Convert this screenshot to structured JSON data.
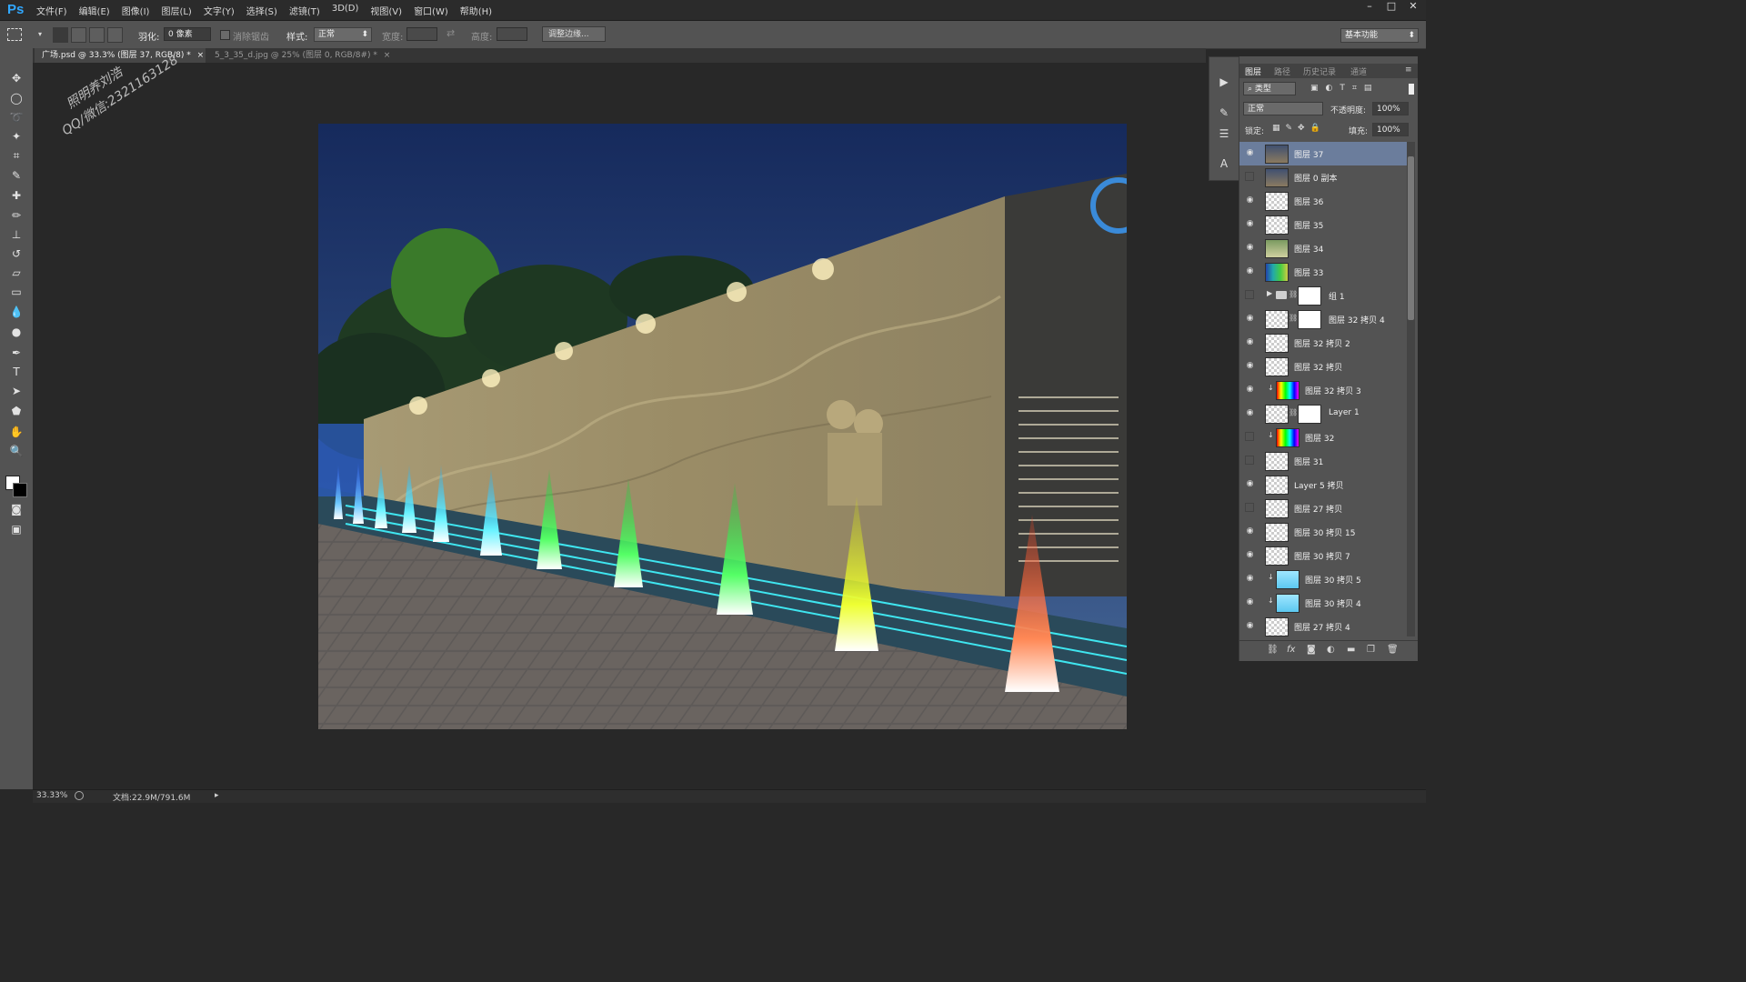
{
  "app": {
    "logo": "Ps",
    "window_controls": [
      "–",
      "□",
      "✕"
    ]
  },
  "menu": [
    "文件(F)",
    "编辑(E)",
    "图像(I)",
    "图层(L)",
    "文字(Y)",
    "选择(S)",
    "滤镜(T)",
    "3D(D)",
    "视图(V)",
    "窗口(W)",
    "帮助(H)"
  ],
  "options_bar": {
    "feather_label": "羽化:",
    "feather_value": "0 像素",
    "antialias_label": "消除锯齿",
    "style_label": "样式:",
    "style_value": "正常",
    "width_label": "宽度:",
    "height_label": "高度:",
    "refine_edge": "调整边缘...",
    "workspace": "基本功能"
  },
  "tabs": [
    {
      "label": "广场.psd @ 33.3% (图层 37, RGB/8) *",
      "close": "×"
    },
    {
      "label": "5_3_35_d.jpg @ 25% (图层 0, RGB/8#) *",
      "close": "×"
    }
  ],
  "watermark": {
    "line1": "照明养刘浩",
    "line2": "QQ/微信:2321163128"
  },
  "layers_panel": {
    "tabs": [
      "图层",
      "路径",
      "历史记录",
      "通道"
    ],
    "filter_kind": "类型",
    "blend_mode": "正常",
    "opacity_label": "不透明度:",
    "opacity_value": "100%",
    "lock_label": "锁定:",
    "fill_label": "填充:",
    "fill_value": "100%",
    "layers": [
      {
        "name": "图层 37",
        "visible": true,
        "selected": true,
        "thumb": "photo",
        "mask": false,
        "clip": false
      },
      {
        "name": "图层 0 副本",
        "visible": false,
        "selected": false,
        "thumb": "photo",
        "mask": false,
        "clip": false
      },
      {
        "name": "图层 36",
        "visible": true,
        "selected": false,
        "thumb": "checker",
        "mask": false,
        "clip": false
      },
      {
        "name": "图层 35",
        "visible": true,
        "selected": false,
        "thumb": "checker",
        "mask": false,
        "clip": false
      },
      {
        "name": "图层 34",
        "visible": true,
        "selected": false,
        "thumb": "green",
        "mask": false,
        "clip": false
      },
      {
        "name": "图层 33",
        "visible": true,
        "selected": false,
        "thumb": "fountain",
        "mask": false,
        "clip": false
      },
      {
        "name": "组 1",
        "visible": false,
        "selected": false,
        "thumb": "group",
        "mask": true,
        "clip": false
      },
      {
        "name": "图层 32 拷贝 4",
        "visible": true,
        "selected": false,
        "thumb": "checker",
        "mask": true,
        "clip": false
      },
      {
        "name": "图层 32 拷贝 2",
        "visible": true,
        "selected": false,
        "thumb": "checker",
        "mask": false,
        "clip": false
      },
      {
        "name": "图层 32 拷贝",
        "visible": true,
        "selected": false,
        "thumb": "checker",
        "mask": false,
        "clip": false
      },
      {
        "name": "图层 32 拷贝 3",
        "visible": true,
        "selected": false,
        "thumb": "rainbow",
        "mask": false,
        "clip": true
      },
      {
        "name": "Layer 1",
        "visible": true,
        "selected": false,
        "thumb": "checker",
        "mask": true,
        "clip": false
      },
      {
        "name": "图层 32",
        "visible": false,
        "selected": false,
        "thumb": "rainbow",
        "mask": false,
        "clip": true
      },
      {
        "name": "图层 31",
        "visible": false,
        "selected": false,
        "thumb": "checker",
        "mask": false,
        "clip": false
      },
      {
        "name": "Layer 5 拷贝",
        "visible": true,
        "selected": false,
        "thumb": "checker",
        "mask": false,
        "clip": false
      },
      {
        "name": "图层 27 拷贝",
        "visible": false,
        "selected": false,
        "thumb": "checker",
        "mask": false,
        "clip": false
      },
      {
        "name": "图层 30 拷贝 15",
        "visible": true,
        "selected": false,
        "thumb": "checker",
        "mask": false,
        "clip": false
      },
      {
        "name": "图层 30 拷贝 7",
        "visible": true,
        "selected": false,
        "thumb": "checker",
        "mask": false,
        "clip": false
      },
      {
        "name": "图层 30 拷贝 5",
        "visible": true,
        "selected": false,
        "thumb": "cyan",
        "mask": false,
        "clip": true
      },
      {
        "name": "图层 30 拷贝 4",
        "visible": true,
        "selected": false,
        "thumb": "cyan",
        "mask": false,
        "clip": true
      },
      {
        "name": "图层 27 拷贝 4",
        "visible": true,
        "selected": false,
        "thumb": "checker",
        "mask": false,
        "clip": false
      }
    ],
    "footer_icons": [
      "link-icon",
      "fx-icon",
      "mask-icon",
      "adjustment-icon",
      "folder-icon",
      "new-layer-icon",
      "trash-icon"
    ]
  },
  "statusbar": {
    "zoom": "33.33%",
    "doc_size": "文档:22.9M/791.6M"
  }
}
